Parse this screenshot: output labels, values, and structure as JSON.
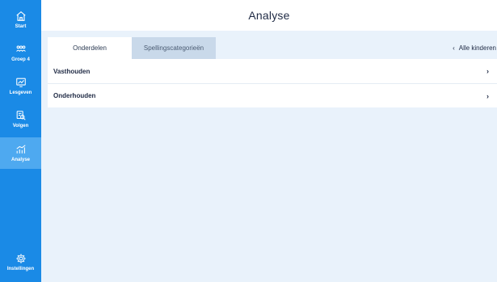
{
  "sidebar": {
    "items": [
      {
        "label": "Start",
        "icon": "home-icon"
      },
      {
        "label": "Groep 4",
        "icon": "group-icon"
      },
      {
        "label": "Lesgeven",
        "icon": "teach-icon"
      },
      {
        "label": "Volgen",
        "icon": "track-icon"
      },
      {
        "label": "Analyse",
        "icon": "analysis-icon",
        "active": true
      }
    ],
    "bottom_item": {
      "label": "Instellingen",
      "icon": "gear-icon"
    }
  },
  "header": {
    "title": "Analyse"
  },
  "tabs": [
    {
      "label": "Onderdelen",
      "active": true
    },
    {
      "label": "Spellingscategorieën",
      "active": false
    }
  ],
  "back_link": {
    "label": "Alle kinderen"
  },
  "list": [
    {
      "label": "Vasthouden"
    },
    {
      "label": "Onderhouden"
    }
  ],
  "colors": {
    "sidebar": "#1a8ae6",
    "sidebar_active": "#4ea9f0",
    "content_bg": "#e9f2fb",
    "tab_inactive": "#c9d9ea",
    "text_dark": "#1f2a44"
  }
}
